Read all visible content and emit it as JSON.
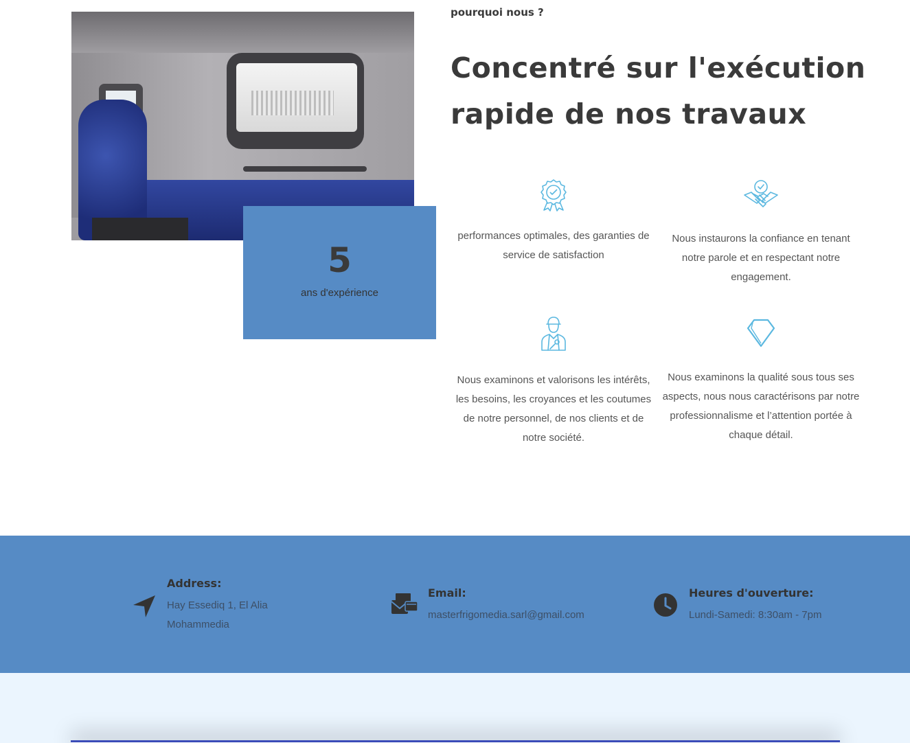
{
  "section": {
    "eyebrow": "pourquoi nous ?",
    "headline": "Concentré sur l'exécution rapide de nos travaux"
  },
  "experience": {
    "number": "5",
    "label": "ans d'expérience"
  },
  "features": [
    {
      "icon": "award-ribbon-icon",
      "text": "performances optimales, des garanties de service de satisfaction"
    },
    {
      "icon": "handshake-icon",
      "text": "Nous instaurons la confiance en tenant notre parole et en respectant notre engagement."
    },
    {
      "icon": "worker-icon",
      "text": "Nous examinons et valorisons les intérêts, les besoins, les croyances et les coutumes de notre personnel, de nos clients et de notre société."
    },
    {
      "icon": "diamond-icon",
      "text": "Nous examinons la qualité sous tous ses aspects, nous nous caractérisons par notre professionnalisme et l’attention portée à chaque détail."
    }
  ],
  "contact": {
    "address": {
      "icon": "location-arrow-icon",
      "title": "Address:",
      "line1": "Hay Essediq 1, El Alia",
      "line2": "Mohammedia"
    },
    "email": {
      "icon": "envelope-icon",
      "title": "Email:",
      "value": "masterfrigomedia.sarl@gmail.com"
    },
    "hours": {
      "icon": "clock-icon",
      "title": "Heures d'ouverture:",
      "value": "Lundi-Samedi: 8:30am - 7pm"
    }
  },
  "colors": {
    "accent_blue": "#568bc5",
    "icon_cyan": "#5bb8e0",
    "text_dark": "#3a3a3a",
    "light_bg": "#ebf5fe"
  }
}
